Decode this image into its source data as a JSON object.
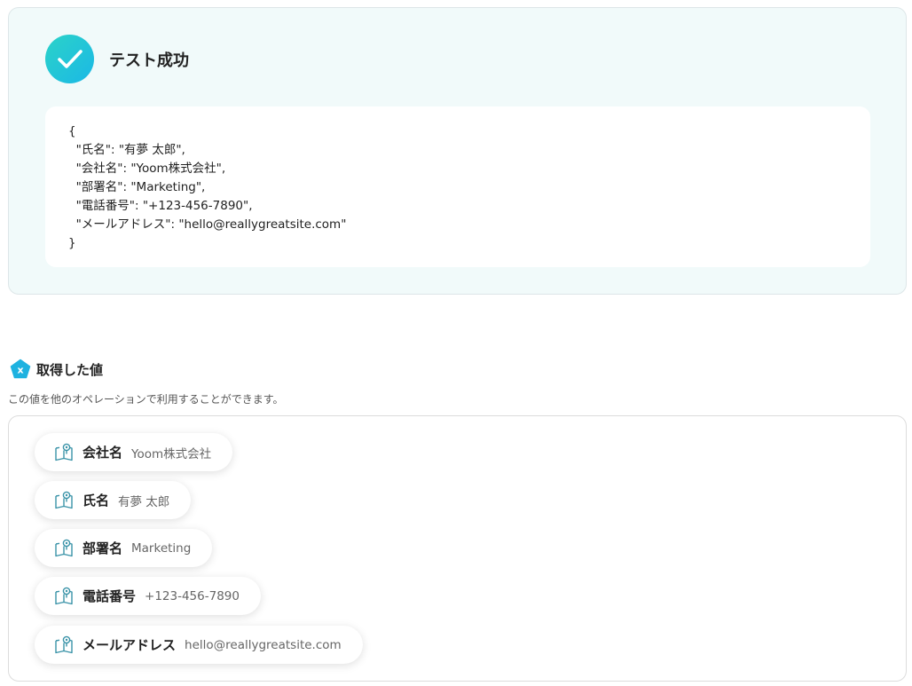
{
  "test_result": {
    "title": "テスト成功",
    "icon": "check-icon",
    "accent_gradient": [
      "#2bd3c8",
      "#1bb8e6"
    ],
    "json_output": "{\n  \"氏名\": \"有夢 太郎\",\n  \"会社名\": \"Yoom株式会社\",\n  \"部署名\": \"Marketing\",\n  \"電話番号\": \"+123-456-7890\",\n  \"メールアドレス\": \"hello@reallygreatsite.com\"\n}"
  },
  "retrieved_values": {
    "title": "取得した値",
    "badge_text": "x",
    "badge_color": "#1eb2e0",
    "description": "この値を他のオペレーションで利用することができます。",
    "items": [
      {
        "label": "会社名",
        "value": "Yoom株式会社",
        "icon": "book-icon"
      },
      {
        "label": "氏名",
        "value": "有夢 太郎",
        "icon": "book-icon"
      },
      {
        "label": "部署名",
        "value": "Marketing",
        "icon": "book-icon"
      },
      {
        "label": "電話番号",
        "value": "+123-456-7890",
        "icon": "book-icon"
      },
      {
        "label": "メールアドレス",
        "value": "hello@reallygreatsite.com",
        "icon": "book-icon"
      }
    ]
  }
}
